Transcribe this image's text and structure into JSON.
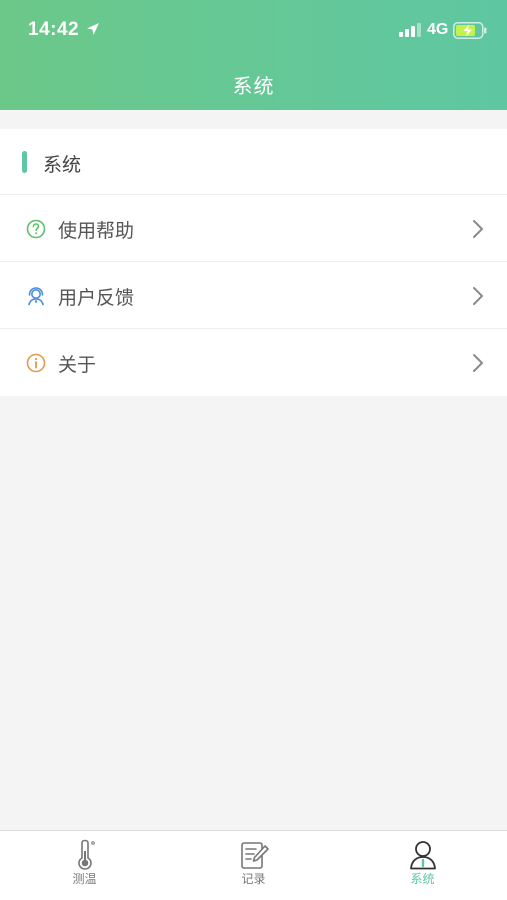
{
  "status_bar": {
    "time": "14:42",
    "network": "4G"
  },
  "header": {
    "title": "系统"
  },
  "section": {
    "title": "系统",
    "items": [
      {
        "label": "使用帮助",
        "icon": "help-circle-icon",
        "icon_color": "#5fbf6c"
      },
      {
        "label": "用户反馈",
        "icon": "headset-user-icon",
        "icon_color": "#4a8fe0"
      },
      {
        "label": "关于",
        "icon": "info-circle-icon",
        "icon_color": "#e39a4e"
      }
    ]
  },
  "tabbar": {
    "tabs": [
      {
        "label": "测温",
        "icon": "thermometer-icon",
        "active": false
      },
      {
        "label": "记录",
        "icon": "notebook-pencil-icon",
        "active": false
      },
      {
        "label": "系统",
        "icon": "user-profile-icon",
        "active": true
      }
    ]
  },
  "colors": {
    "header_start": "#6cc889",
    "header_end": "#5ec7a2",
    "accent": "#5cc7a0",
    "background": "#f4f4f4"
  }
}
